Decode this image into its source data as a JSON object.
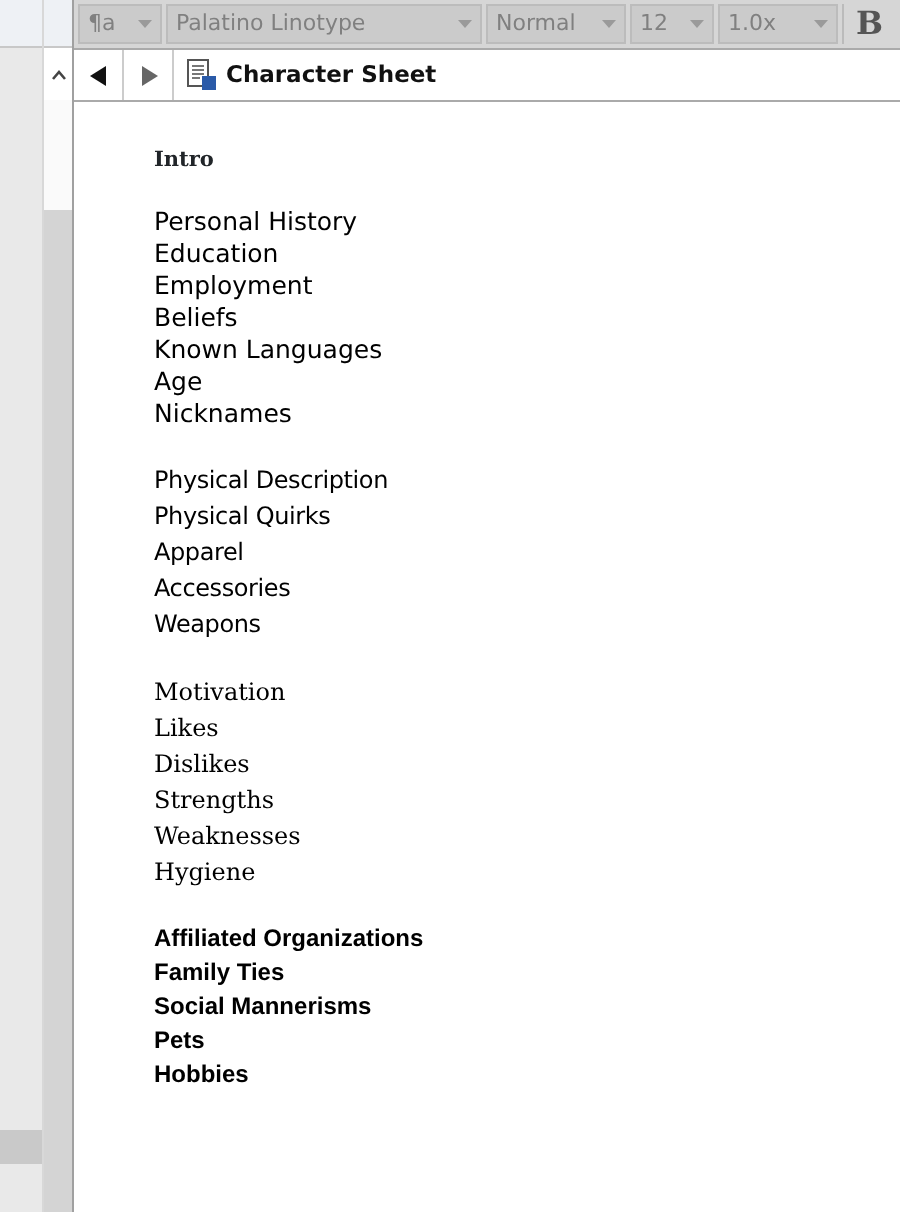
{
  "toolbar": {
    "dropdowns": [
      {
        "value": "¶a",
        "disabled": true
      },
      {
        "value": "Palatino Linotype",
        "disabled": true
      },
      {
        "value": "Normal",
        "disabled": true
      },
      {
        "value": "12",
        "disabled": true
      },
      {
        "value": "1.0x",
        "disabled": true
      }
    ],
    "bold_button": "B"
  },
  "navigation": {
    "title": "Character Sheet"
  },
  "document": {
    "heading": "Intro",
    "groups": [
      {
        "kind": "sans",
        "items": [
          "Personal History",
          "Education",
          "Employment",
          "Beliefs",
          "Known Languages",
          "Age",
          "Nicknames"
        ]
      },
      {
        "kind": "casual",
        "items": [
          "Physical Description",
          "Physical Quirks",
          "Apparel",
          "Accessories",
          "Weapons"
        ]
      },
      {
        "kind": "serif",
        "items": [
          "Motivation",
          "Likes",
          "Dislikes",
          "Strengths",
          "Weaknesses",
          "Hygiene"
        ]
      },
      {
        "kind": "gothic",
        "items": [
          "Affiliated Organizations",
          "Family Ties",
          "Social Mannerisms",
          "Pets",
          "Hobbies"
        ]
      }
    ]
  }
}
